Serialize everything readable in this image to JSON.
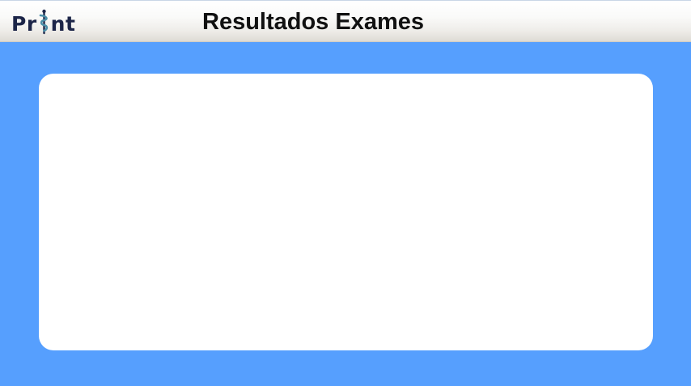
{
  "app": {
    "logo_text_left": "Pr",
    "logo_text_right": "nt",
    "logo_glyph": "caduceus-icon",
    "title": "Resultados Exames"
  },
  "colors": {
    "background": "#569ffe",
    "panel": "#ffffff",
    "logo_dark": "#1c2548",
    "logo_accent": "#4a8ea8",
    "title_text": "#111111"
  },
  "main": {
    "results_panel": {
      "items": []
    }
  }
}
